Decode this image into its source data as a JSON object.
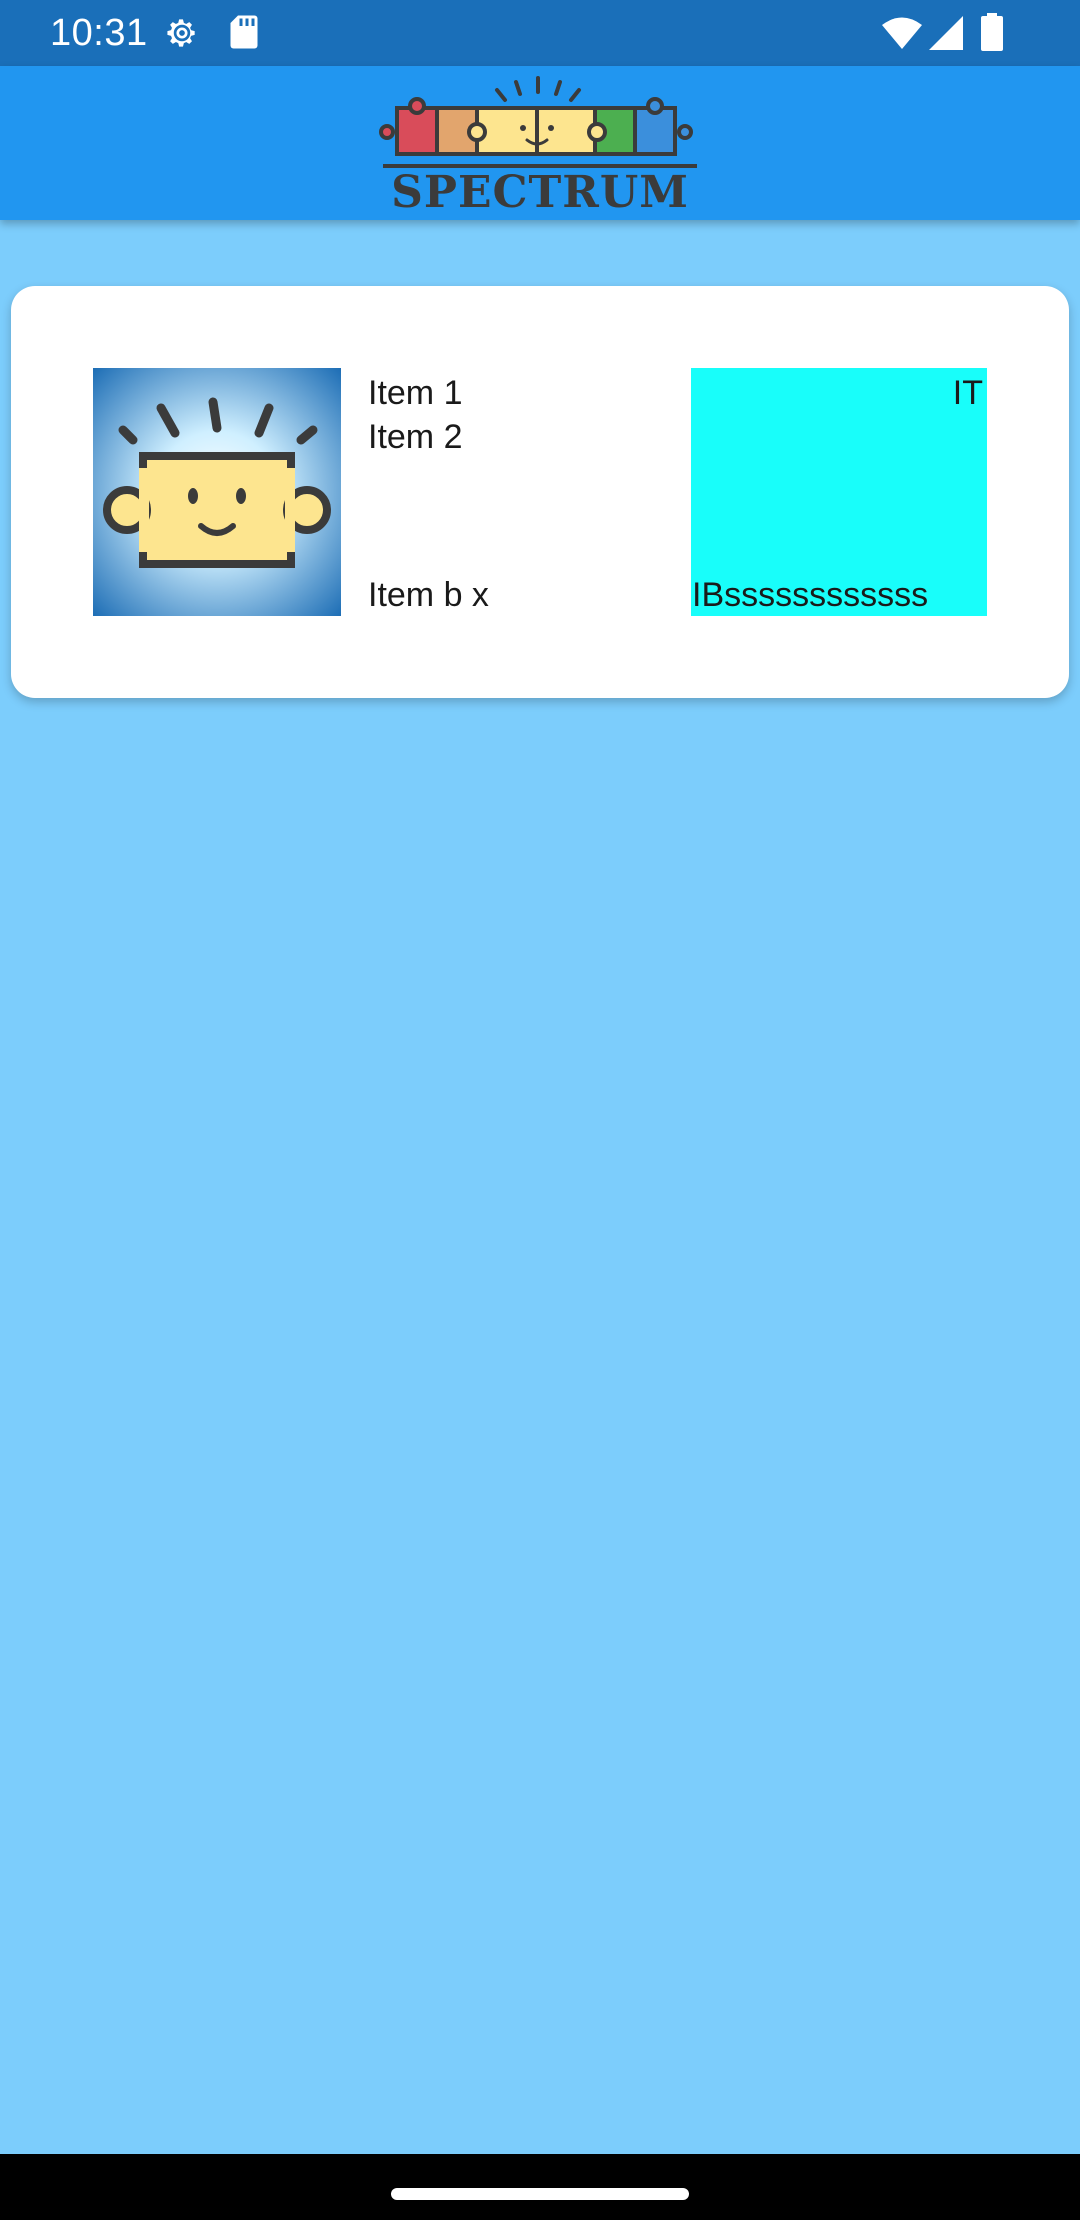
{
  "status_bar": {
    "time": "10:31",
    "icons": [
      "gear-icon",
      "sdcard-icon",
      "wifi-icon",
      "signal-icon",
      "battery-icon"
    ]
  },
  "app_bar": {
    "logo_text": "SPECTRUM",
    "colors": {
      "background": "#2196f0",
      "puzzle": [
        "#d94c5a",
        "#e2a56d",
        "#fde58f",
        "#4caf50",
        "#3b8fdc"
      ]
    }
  },
  "card": {
    "items": [
      "Item 1",
      "Item 2",
      "Item b x"
    ],
    "box": {
      "top_text": "IT",
      "bottom_text": "IBssssssssssss",
      "color": "#18fefa"
    }
  },
  "colors": {
    "page_background": "#7ccdfc",
    "status_bar": "#1a6fb9"
  }
}
